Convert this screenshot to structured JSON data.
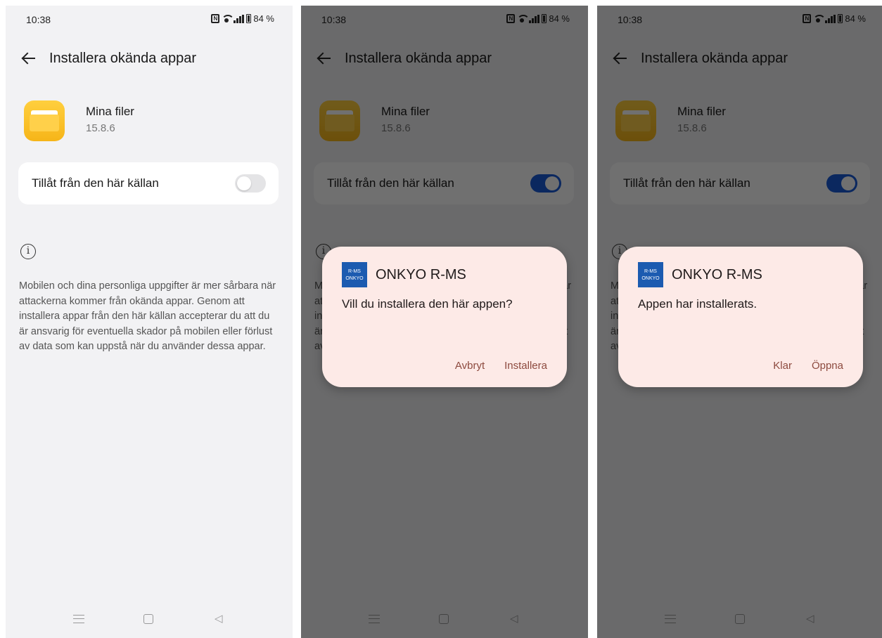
{
  "status": {
    "time": "10:38",
    "battery": "84 %",
    "nfc": "N"
  },
  "header": {
    "title": "Installera okända appar"
  },
  "app": {
    "name": "Mina filer",
    "version": "15.8.6"
  },
  "toggle": {
    "label": "Tillåt från den här källan"
  },
  "info": {
    "text": "Mobilen och dina personliga uppgifter är mer sårbara när attackerna kommer från okända appar. Genom att installera appar från den här källan accepterar du att du är ansvarig för eventuella skador på mobilen eller förlust av data som kan uppstå när du använder dessa appar."
  },
  "dialog_install": {
    "logo_top": "R-MS",
    "logo_bottom": "ONKYO",
    "title": "ONKYO R-MS",
    "message": "Vill du installera den här appen?",
    "cancel": "Avbryt",
    "confirm": "Installera"
  },
  "dialog_done": {
    "logo_top": "R-MS",
    "logo_bottom": "ONKYO",
    "title": "ONKYO R-MS",
    "message": "Appen har installerats.",
    "done": "Klar",
    "open": "Öppna"
  },
  "colors": {
    "accent_toggle_on": "#1a5bd8",
    "dialog_bg": "#fdeae7",
    "dialog_button": "#8d4a3f",
    "folder_icon": "#f6b519"
  }
}
